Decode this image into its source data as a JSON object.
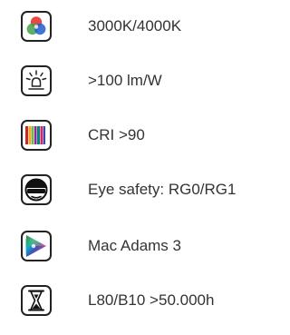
{
  "specs": [
    {
      "icon": "rgb-color-mix-icon",
      "label": "3000K/4000K"
    },
    {
      "icon": "light-bulb-icon",
      "label": ">100 lm/W"
    },
    {
      "icon": "color-rendering-bars-icon",
      "label": "CRI >90"
    },
    {
      "icon": "face-with-sunglasses-icon",
      "label": "Eye safety: RG0/RG1"
    },
    {
      "icon": "chromaticity-diagram-icon",
      "label": "Mac Adams 3"
    },
    {
      "icon": "hourglass-icon",
      "label": "L80/B10 >50.000h"
    }
  ],
  "colors": {
    "text": "#333333",
    "icon_border": "#222222",
    "red": "#e53935",
    "green": "#43a047",
    "blue": "#1e5fd0"
  }
}
